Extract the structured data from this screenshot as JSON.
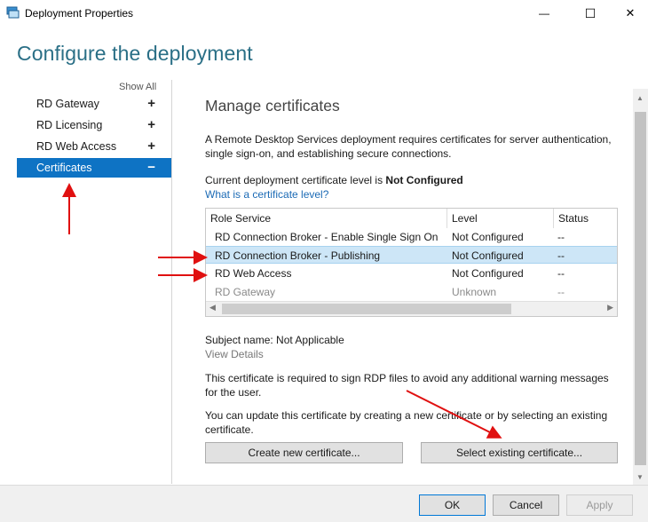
{
  "window": {
    "title": "Deployment Properties",
    "minimize_glyph": "—",
    "maximize_glyph": "☐",
    "close_glyph": "✕"
  },
  "page": {
    "heading": "Configure the deployment"
  },
  "sidebar": {
    "show_all": "Show All",
    "items": [
      {
        "label": "RD Gateway",
        "toggle": "+"
      },
      {
        "label": "RD Licensing",
        "toggle": "+"
      },
      {
        "label": "RD Web Access",
        "toggle": "+"
      },
      {
        "label": "Certificates",
        "toggle": "−"
      }
    ]
  },
  "content": {
    "heading": "Manage certificates",
    "description": "A Remote Desktop Services deployment requires certificates for server authentication, single sign-on, and establishing secure connections.",
    "level_prefix": "Current deployment certificate level is ",
    "level_value": "Not Configured",
    "level_link": "What is a certificate level?"
  },
  "table": {
    "columns": [
      "Role Service",
      "Level",
      "Status"
    ],
    "rows": [
      {
        "role": "RD Connection Broker - Enable Single Sign On",
        "level": "Not Configured",
        "status": "--"
      },
      {
        "role": "RD Connection Broker - Publishing",
        "level": "Not Configured",
        "status": "--"
      },
      {
        "role": "RD Web Access",
        "level": "Not Configured",
        "status": "--"
      },
      {
        "role": "RD Gateway",
        "level": "Unknown",
        "status": "--"
      }
    ]
  },
  "details": {
    "subject": "Subject name: Not Applicable",
    "view_details": "View Details",
    "note_required": "This certificate is required to sign RDP files to avoid any additional warning messages for the user.",
    "note_update": "You can update this certificate by creating a new certificate or by selecting an existing certificate.",
    "create_button": "Create new certificate...",
    "select_button": "Select existing certificate..."
  },
  "footer": {
    "ok": "OK",
    "cancel": "Cancel",
    "apply": "Apply"
  },
  "colors": {
    "accent": "#0e73c4",
    "heading": "#2a6f86",
    "annotation": "#e01010"
  }
}
